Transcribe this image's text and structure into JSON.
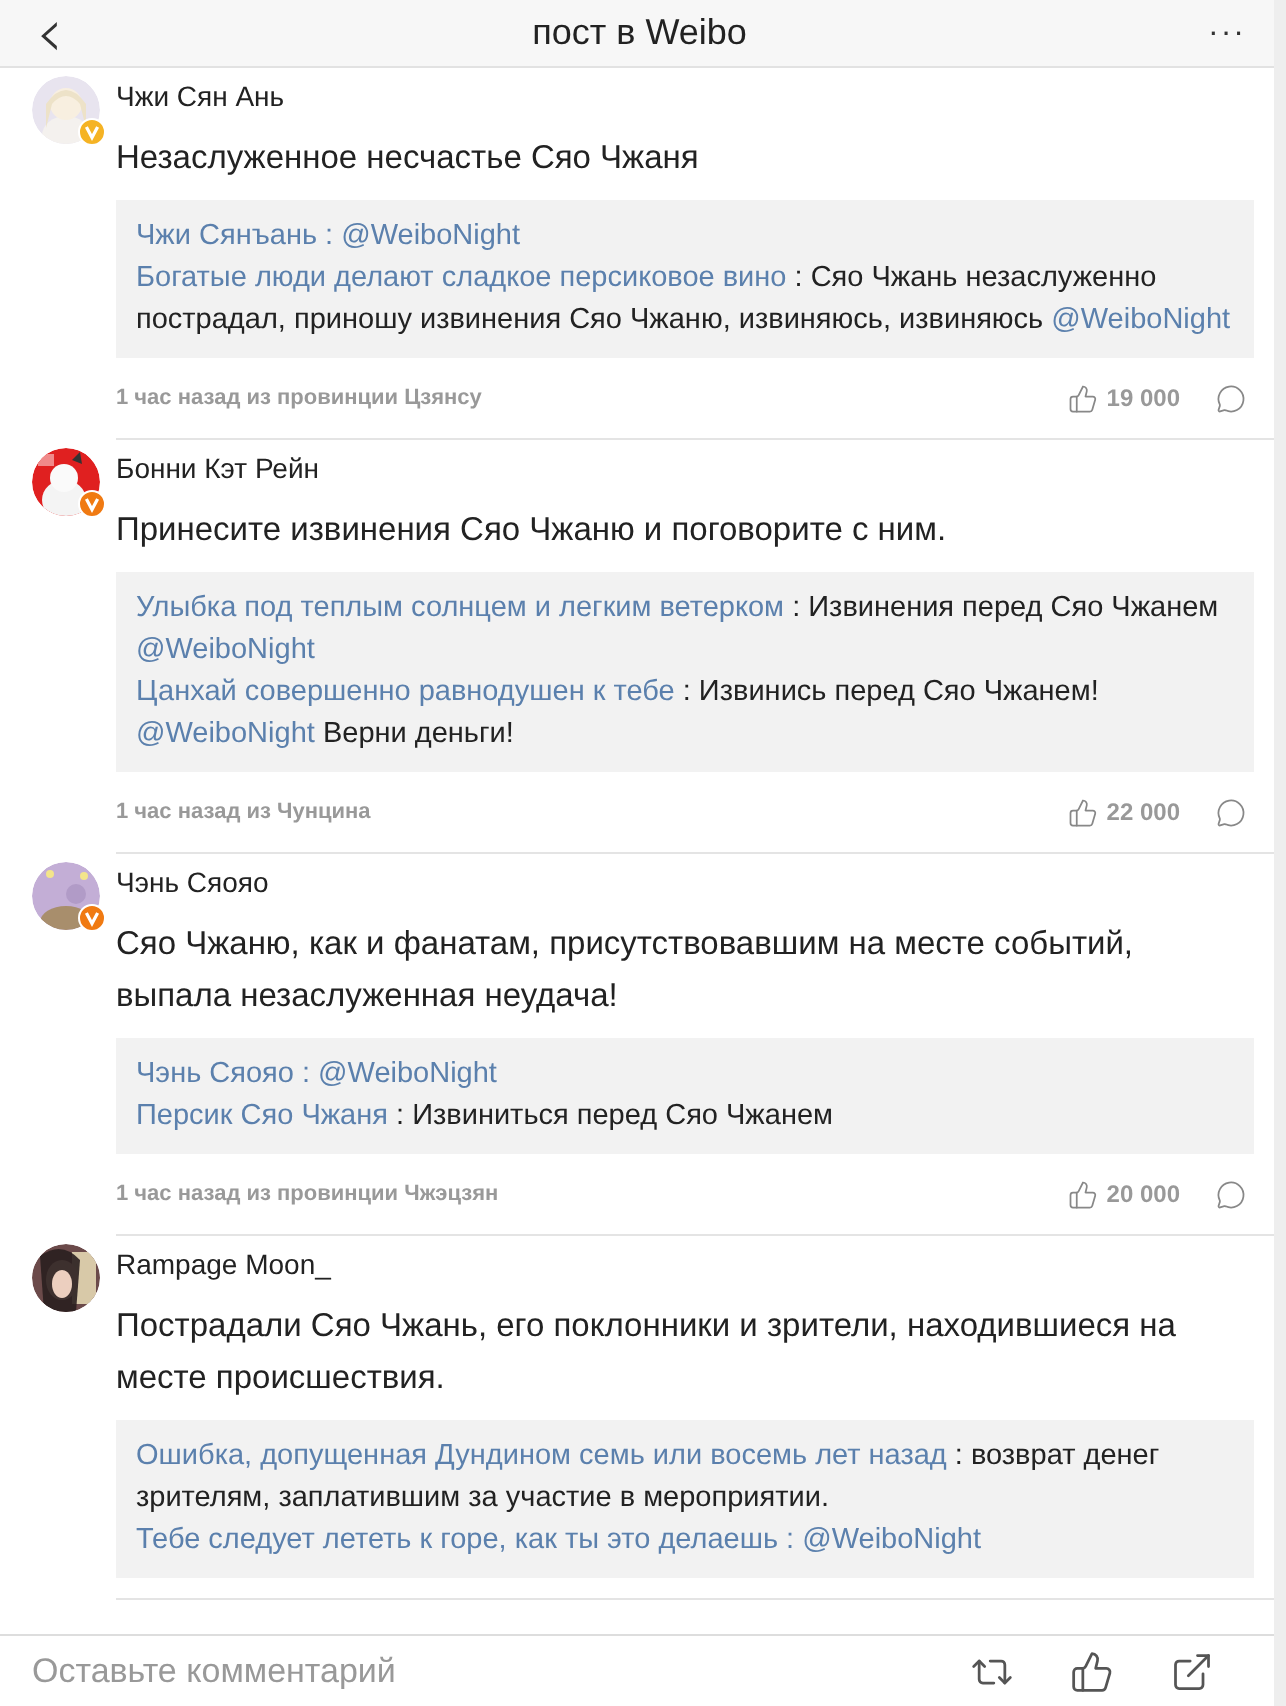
{
  "header": {
    "back": "‹",
    "title": "пост в Weibo",
    "more": "···"
  },
  "comments": [
    {
      "author": "Чжи Сян Ань",
      "verified": true,
      "text": "Незаслуженное несчастье Сяо Чжаня",
      "replies": [
        {
          "parts": [
            {
              "kind": "user",
              "text": "Чжи Сянъань :"
            },
            {
              "kind": "mention",
              "text": "@WeiboNight"
            }
          ]
        },
        {
          "parts": [
            {
              "kind": "user",
              "text": "Богатые люди делают сладкое персиковое вино"
            },
            {
              "kind": "text",
              "text": ": Сяо Чжань незаслуженно пострадал, приношу извинения Сяо Чжаню, извиняюсь, извиняюсь"
            },
            {
              "kind": "mention",
              "text": "@WeiboNight"
            }
          ]
        }
      ],
      "meta": {
        "time": "1 час назад из провинции Цзянсу",
        "likes": "19 000"
      }
    },
    {
      "author": "Бонни Кэт Рейн",
      "verified": true,
      "text": "Принесите извинения Сяо Чжаню и поговорите с ним.",
      "replies": [
        {
          "parts": [
            {
              "kind": "user",
              "text": "Улыбка под теплым солнцем и легким ветерком"
            },
            {
              "kind": "text",
              "text": ": Извинения перед Сяо Чжанем"
            },
            {
              "kind": "mention",
              "text": "@WeiboNight"
            }
          ]
        },
        {
          "parts": [
            {
              "kind": "user",
              "text": "Цанхай совершенно равнодушен к тебе"
            },
            {
              "kind": "text",
              "text": ": Извинись перед Сяо Чжанем!"
            },
            {
              "kind": "mention",
              "text": "@WeiboNight"
            },
            {
              "kind": "text",
              "text": "Верни деньги!"
            }
          ]
        }
      ],
      "meta": {
        "time": "1 час назад из Чунцина",
        "likes": "22 000"
      }
    },
    {
      "author": "Чэнь Сяояо",
      "verified": true,
      "text": "Сяо Чжаню, как и фанатам, присутствовавшим на месте событий, выпала незаслуженная неудача!",
      "replies": [
        {
          "parts": [
            {
              "kind": "user",
              "text": "Чэнь Сяояо :"
            },
            {
              "kind": "mention",
              "text": "@WeiboNight"
            }
          ]
        },
        {
          "parts": [
            {
              "kind": "user",
              "text": "Персик Сяо Чжаня"
            },
            {
              "kind": "text",
              "text": ": Извиниться перед Сяо Чжанем"
            }
          ]
        }
      ],
      "meta": {
        "time": "1 час назад из провинции Чжэцзян",
        "likes": "20 000"
      }
    },
    {
      "author": "Rampage Moon_",
      "verified": false,
      "text": "Пострадали Сяо Чжань, его поклонники и зрители, находившиеся на месте происшествия.",
      "replies": [
        {
          "parts": [
            {
              "kind": "user",
              "text": "Ошибка, допущенная Дундином семь или восемь лет назад"
            },
            {
              "kind": "text",
              "text": ": возврат денег зрителям, заплатившим за участие в мероприятии."
            }
          ]
        },
        {
          "parts": [
            {
              "kind": "user",
              "text": "Тебе следует лететь к горе, как ты это делаешь :"
            },
            {
              "kind": "mention",
              "text": "@WeiboNight"
            }
          ]
        }
      ]
    }
  ],
  "comment_bar": {
    "placeholder": "Оставьте комментарий"
  }
}
